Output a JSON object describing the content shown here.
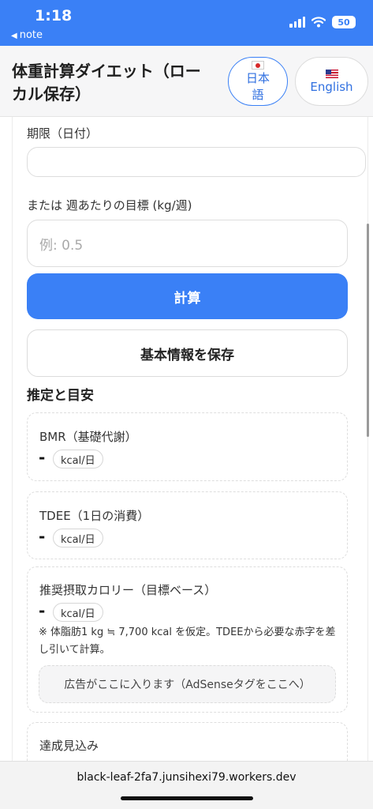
{
  "status": {
    "time": "1:18",
    "back_label": "note",
    "battery": "50"
  },
  "header": {
    "title": "体重計算ダイエット（ローカル保存）",
    "lang_ja": {
      "label": "日本語"
    },
    "lang_en": {
      "label": "English"
    }
  },
  "form": {
    "deadline_label": "期限（日付）",
    "deadline_value": "",
    "weekly_label": "または 週あたりの目標 (kg/週)",
    "weekly_placeholder": "例: 0.5",
    "calc_button": "計算",
    "save_button": "基本情報を保存"
  },
  "estimates": {
    "title": "推定と目安",
    "bmr": {
      "label": "BMR（基礎代謝）",
      "value": "-",
      "unit": "kcal/日"
    },
    "tdee": {
      "label": "TDEE（1日の消費）",
      "value": "-",
      "unit": "kcal/日"
    },
    "intake": {
      "label": "推奨摂取カロリー（目標ベース）",
      "value": "-",
      "unit": "kcal/日",
      "note": "※ 体脂肪1 kg ≒ 7,700 kcal を仮定。TDEEから必要な赤字を差し引いて計算。",
      "ad": "広告がここに入ります（AdSenseタグをここへ）"
    },
    "forecast": {
      "label": "達成見込み"
    }
  },
  "browser": {
    "url": "black-leaf-2fa7.junsihexi79.workers.dev"
  },
  "colors": {
    "accent": "#3a80f6",
    "header_bg": "#f6f6f7"
  }
}
